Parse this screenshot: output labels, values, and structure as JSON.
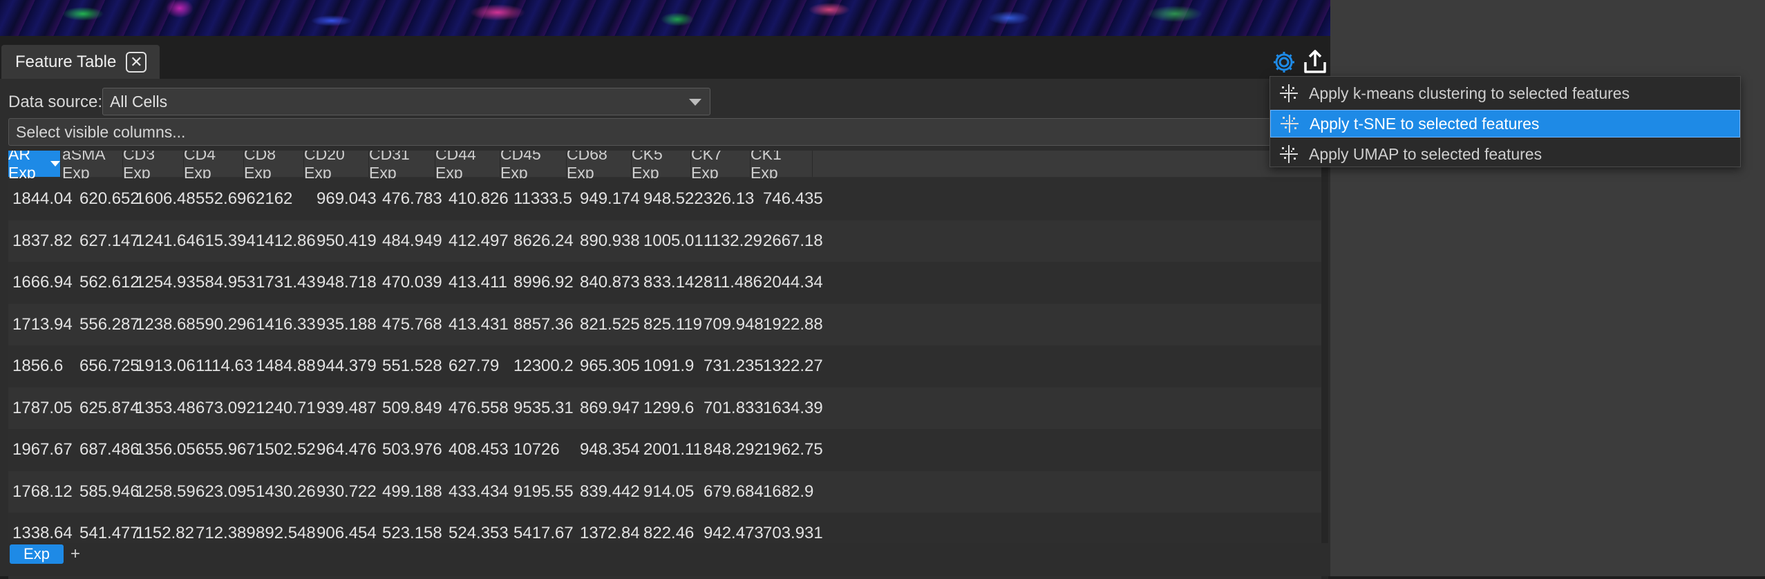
{
  "panel": {
    "tab_label": "Feature Table",
    "tab_close_glyph": "✕"
  },
  "toolbar": {
    "icons": [
      "gear-icon",
      "export-icon"
    ],
    "accent": "#1e8ae6"
  },
  "datasource": {
    "label": "Data source:",
    "selected": "All Cells"
  },
  "columns_selector": {
    "placeholder": "Select visible columns..."
  },
  "table": {
    "active_sort_column": 0,
    "headers": [
      "AR Exp",
      "aSMA Exp",
      "CD3 Exp",
      "CD4 Exp",
      "CD8 Exp",
      "CD20 Exp",
      "CD31 Exp",
      "CD44 Exp",
      "CD45 Exp",
      "CD68 Exp",
      "CK5 Exp",
      "CK7 Exp",
      "CK1 Exp"
    ],
    "rows": [
      [
        "1844.04",
        "620.652",
        "1606.48",
        "552.696",
        "2162",
        "969.043",
        "476.783",
        "410.826",
        "11333.5",
        "949.174",
        "948.522",
        "326.13",
        "746.435"
      ],
      [
        "1837.82",
        "627.147",
        "1241.64",
        "615.394",
        "1412.86",
        "950.419",
        "484.949",
        "412.497",
        "8626.24",
        "890.938",
        "1005.01",
        "1132.29",
        "2667.18"
      ],
      [
        "1666.94",
        "562.612",
        "1254.93",
        "584.953",
        "1731.43",
        "948.718",
        "470.039",
        "413.411",
        "8996.92",
        "840.873",
        "833.142",
        "811.486",
        "2044.34"
      ],
      [
        "1713.94",
        "556.287",
        "1238.68",
        "590.296",
        "1416.33",
        "935.188",
        "475.768",
        "413.431",
        "8857.36",
        "821.525",
        "825.119",
        "709.948",
        "1922.88"
      ],
      [
        "1856.6",
        "656.725",
        "1913.06",
        "1114.63",
        "1484.88",
        "944.379",
        "551.528",
        "627.79",
        "12300.2",
        "965.305",
        "1091.9",
        "731.235",
        "1322.27"
      ],
      [
        "1787.05",
        "625.874",
        "1353.48",
        "673.092",
        "1240.71",
        "939.487",
        "509.849",
        "476.558",
        "9535.31",
        "869.947",
        "1299.6",
        "701.833",
        "1634.39"
      ],
      [
        "1967.67",
        "687.486",
        "1356.05",
        "655.967",
        "1502.52",
        "964.476",
        "503.976",
        "408.453",
        "10726",
        "948.354",
        "2001.11",
        "848.292",
        "1962.75"
      ],
      [
        "1768.12",
        "585.946",
        "1258.59",
        "623.095",
        "1430.26",
        "930.722",
        "499.188",
        "433.434",
        "9195.55",
        "839.442",
        "914.05",
        "679.684",
        "1682.9"
      ],
      [
        "1338.64",
        "541.477",
        "1152.82",
        "712.389",
        "892.548",
        "906.454",
        "523.158",
        "524.353",
        "5417.67",
        "1372.84",
        "822.46",
        "942.473",
        "703.931"
      ]
    ]
  },
  "sheets": {
    "tabs": [
      "Exp"
    ],
    "add_glyph": "+"
  },
  "menu": {
    "items": [
      {
        "label": "Apply k-means clustering to selected features",
        "highlighted": false
      },
      {
        "label": "Apply t-SNE to selected features",
        "highlighted": true
      },
      {
        "label": "Apply UMAP to selected features",
        "highlighted": false
      }
    ]
  }
}
